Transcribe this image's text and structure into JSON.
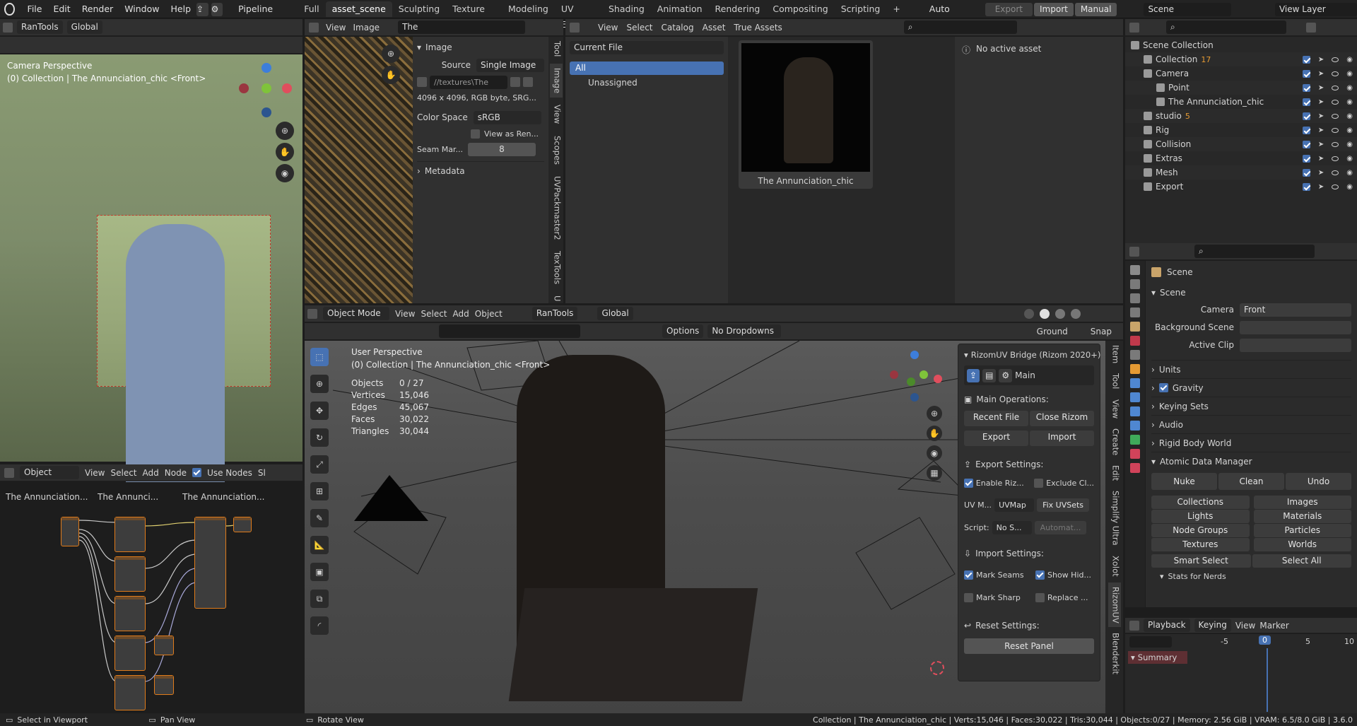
{
  "topbar": {
    "menus": [
      "File",
      "Edit",
      "Render",
      "Window",
      "Help"
    ],
    "pipeline": "Pipeline",
    "workspaces": [
      "Full",
      "asset_scene",
      "Sculpting",
      "Texture Paint",
      "Modeling",
      "UV Editing",
      "Shading",
      "Animation",
      "Rendering",
      "Compositing",
      "Scripting"
    ],
    "active_workspace": "asset_scene",
    "auto_reload": "Auto Reload",
    "export": "Export",
    "import": "Import",
    "manual": "Manual",
    "scene": "Scene",
    "view_layer": "View Layer"
  },
  "cam_view": {
    "header_tools": "RanTools",
    "header_orient": "Global",
    "title": "Camera Perspective",
    "subtitle": "(0) Collection | The Annunciation_chic <Front>"
  },
  "node_editor": {
    "mode": "Object",
    "menus": [
      "View",
      "Select",
      "Add",
      "Node"
    ],
    "use_nodes": "Use Nodes",
    "slot": "Sl",
    "breadcrumb": [
      "The Annunciation...",
      "The Annunci...",
      "The Annunciation..."
    ]
  },
  "image_editor": {
    "menus": [
      "View",
      "Image"
    ],
    "image_name": "The Annunciation_chic_basecolor.jpe",
    "panel_title": "Image",
    "source_label": "Source",
    "source_value": "Single Image",
    "path": "//textures\\The An...",
    "info": "4096 x 4096,  RGB byte,  SRG...",
    "colorspace_label": "Color Space",
    "colorspace_value": "sRGB",
    "view_as_render": "View as Ren...",
    "seam_label": "Seam Mar...",
    "seam_value": "8",
    "metadata": "Metadata",
    "tabs": [
      "Tool",
      "Image",
      "View",
      "Scopes",
      "UVPackmaster2",
      "TexTools",
      "U"
    ]
  },
  "asset_browser": {
    "menus": [
      "View",
      "Select",
      "Catalog",
      "Asset",
      "True Assets"
    ],
    "library": "Current File",
    "catalogs": [
      "All",
      "Unassigned"
    ],
    "asset_name": "The Annunciation_chic",
    "no_active": "No active asset"
  },
  "outliner": {
    "items": [
      {
        "label": "Scene Collection",
        "indent": 0
      },
      {
        "label": "Collection",
        "indent": 1,
        "badge": "17"
      },
      {
        "label": "Camera",
        "indent": 1
      },
      {
        "label": "Point",
        "indent": 2
      },
      {
        "label": "The Annunciation_chic",
        "indent": 2
      },
      {
        "label": "studio",
        "indent": 1,
        "badge": "5"
      },
      {
        "label": "Rig",
        "indent": 1
      },
      {
        "label": "Collision",
        "indent": 1
      },
      {
        "label": "Extras",
        "indent": 1
      },
      {
        "label": "Mesh",
        "indent": 1
      },
      {
        "label": "Export",
        "indent": 1
      }
    ]
  },
  "properties": {
    "title": "Scene",
    "scene_section": "Scene",
    "camera_label": "Camera",
    "camera_value": "Front",
    "bg_scene_label": "Background Scene",
    "active_clip_label": "Active Clip",
    "sections": [
      "Units",
      "Gravity",
      "Keying Sets",
      "Audio",
      "Rigid Body World",
      "Atomic Data Manager"
    ],
    "atomic_buttons": [
      "Nuke",
      "Clean",
      "Undo"
    ],
    "atomic_grid": [
      "Collections",
      "Images",
      "Lights",
      "Materials",
      "Node Groups",
      "Particles",
      "Textures",
      "Worlds"
    ],
    "smart_select": "Smart Select",
    "select_all": "Select All",
    "stats_for_nerds": "Stats for Nerds"
  },
  "timeline": {
    "menus": [
      "Playback",
      "Keying",
      "View",
      "Marker"
    ],
    "ticks": [
      "-5",
      "0",
      "5",
      "10"
    ],
    "current_frame": "0",
    "summary": "Summary"
  },
  "viewport": {
    "mode": "Object Mode",
    "menus": [
      "View",
      "Select",
      "Add",
      "Object"
    ],
    "tools": "RanTools",
    "orient": "Global",
    "options": "Options",
    "dropdowns": "No Dropdowns",
    "ground": "Ground",
    "snap": "Snap",
    "title": "User Perspective",
    "subtitle": "(0) Collection | The Annunciation_chic <Front>",
    "stats": [
      {
        "label": "Objects",
        "value": "0 / 27"
      },
      {
        "label": "Vertices",
        "value": "15,046"
      },
      {
        "label": "Edges",
        "value": "45,067"
      },
      {
        "label": "Faces",
        "value": "30,022"
      },
      {
        "label": "Triangles",
        "value": "30,044"
      }
    ],
    "tabs": [
      "Item",
      "Tool",
      "View",
      "Create",
      "Edit",
      "Simplify Ultra",
      "Xolot",
      "RizomUV",
      "Blenderkit"
    ]
  },
  "rizom": {
    "title": "RizomUV Bridge (Rizom 2020+)",
    "main": "Main",
    "main_ops": "Main Operations:",
    "recent_file": "Recent File",
    "close_rizom": "Close Rizom",
    "export": "Export",
    "import": "Import",
    "export_settings": "Export Settings:",
    "enable_riz": "Enable Riz...",
    "exclude_cl": "Exclude Cl...",
    "uv_map_label": "UV M...",
    "uv_map_value": "UVMap",
    "fix_uvsets": "Fix UVSets",
    "script_label": "Script:",
    "script_value": "No S...",
    "automat": "Automat...",
    "import_settings": "Import Settings:",
    "mark_seams": "Mark Seams",
    "show_hid": "Show Hid...",
    "mark_sharp": "Mark Sharp",
    "replace": "Replace ...",
    "reset_settings": "Reset Settings:",
    "reset_panel": "Reset Panel"
  },
  "statusbar": {
    "left1": "Select in Viewport",
    "left2": "Pan View",
    "left3": "Rotate View",
    "right": "Collection | The Annunciation_chic | Verts:15,046 | Faces:30,022 | Tris:30,044 | Objects:0/27 | Memory: 2.56 GiB | VRAM: 6.5/8.0 GiB | 3.6.0"
  }
}
